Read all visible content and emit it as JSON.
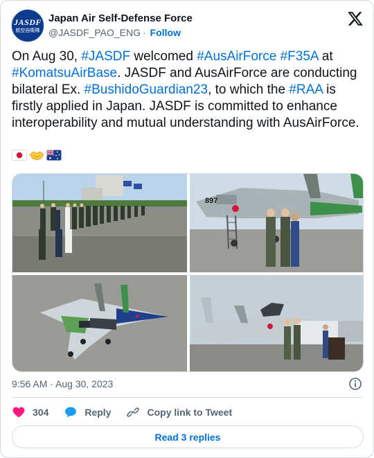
{
  "author": {
    "display_name": "Japan Air Self-Defense Force",
    "handle": "@JASDF_PAO_ENG",
    "separator": "·",
    "follow_label": "Follow",
    "avatar_text_top": "JASDF",
    "avatar_text_bottom": "航空自衛隊"
  },
  "tweet": {
    "segments": [
      {
        "text": "On Aug 30, ",
        "tag": false
      },
      {
        "text": "#JASDF",
        "tag": true
      },
      {
        "text": " welcomed ",
        "tag": false
      },
      {
        "text": "#AusAirForce",
        "tag": true
      },
      {
        "text": " ",
        "tag": false
      },
      {
        "text": "#F35A",
        "tag": true
      },
      {
        "text": " at ",
        "tag": false
      },
      {
        "text": "#KomatsuAirBase",
        "tag": true
      },
      {
        "text": ". JASDF and AusAirForce are conducting bilateral Ex. ",
        "tag": false
      },
      {
        "text": "#BushidoGuardian23",
        "tag": true
      },
      {
        "text": ", to which the ",
        "tag": false
      },
      {
        "text": "#RAA",
        "tag": true
      },
      {
        "text": " is firstly applied in Japan. JASDF is committed to enhance interoperability and mutual understanding with AusAirForce.",
        "tag": false
      }
    ],
    "emoji": [
      "japan-flag",
      "handshake",
      "australia-flag"
    ]
  },
  "media": {
    "images": [
      "jasdf-personnel-lineup",
      "f15-handshake",
      "f15-special-livery",
      "f15-ceremony-podium"
    ],
    "aircraft_tail_number": "897"
  },
  "meta": {
    "timestamp": "9:56 AM · Aug 30, 2023"
  },
  "actions": {
    "like_count": "304",
    "reply_label": "Reply",
    "copy_label": "Copy link to Tweet",
    "read_replies_label": "Read 3 replies"
  },
  "colors": {
    "link": "#006fd6",
    "like": "#f91880",
    "reply_icon": "#1d9bf0",
    "muted": "#536471",
    "border": "#cfd9de"
  }
}
